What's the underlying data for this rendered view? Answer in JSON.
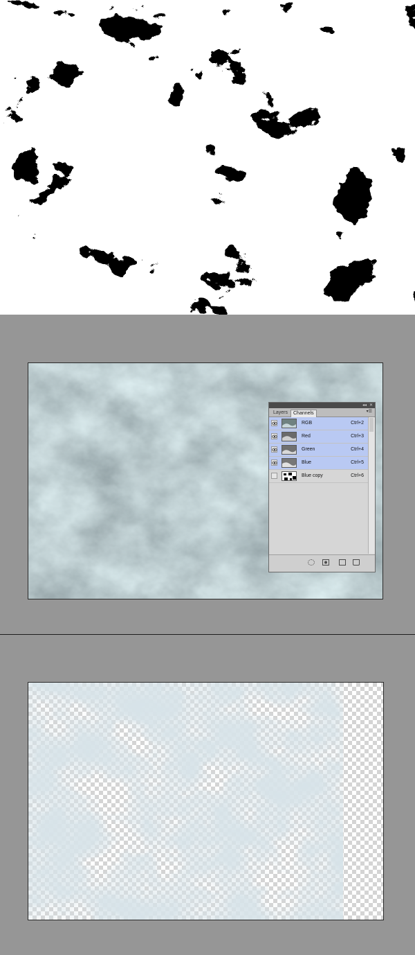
{
  "panel": {
    "tabs": [
      "Layers",
      "Channels"
    ],
    "active_tab": "Channels",
    "channels": [
      {
        "name": "RGB",
        "shortcut": "Ctrl+2",
        "visible": true,
        "selected": true
      },
      {
        "name": "Red",
        "shortcut": "Ctrl+3",
        "visible": true,
        "selected": true
      },
      {
        "name": "Green",
        "shortcut": "Ctrl+4",
        "visible": true,
        "selected": true
      },
      {
        "name": "Blue",
        "shortcut": "Ctrl+5",
        "visible": true,
        "selected": true
      },
      {
        "name": "Blue copy",
        "shortcut": "Ctrl+6",
        "visible": false,
        "selected": false
      }
    ],
    "footer_icons": [
      "load-selection-icon",
      "save-selection-icon",
      "new-channel-icon",
      "delete-channel-icon"
    ]
  },
  "colors": {
    "workspace_bg": "#969696",
    "selection_highlight": "#b9c9f3",
    "water_dark": "#5d6f6f",
    "foam": "#e6eef2"
  }
}
